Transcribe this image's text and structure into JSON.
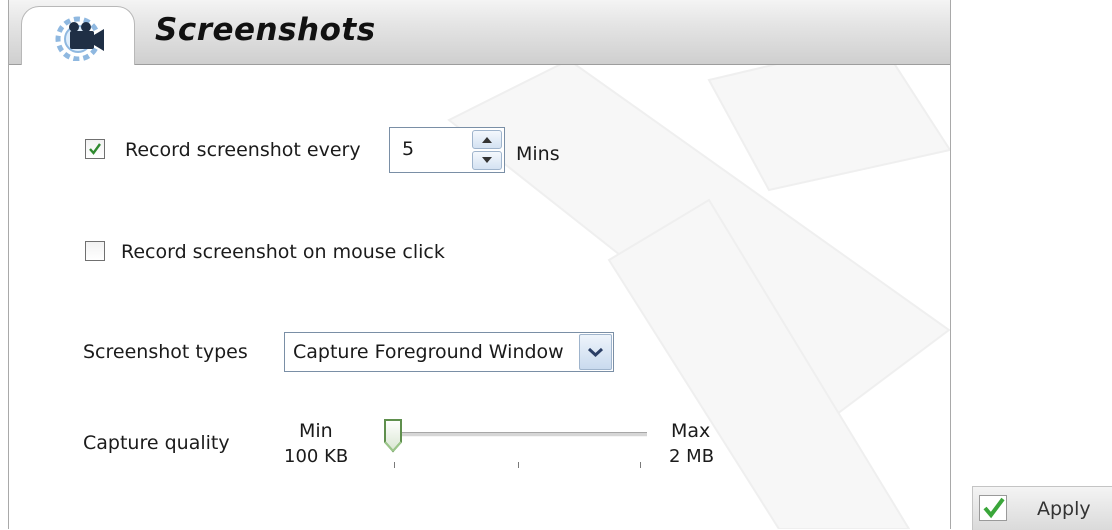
{
  "header": {
    "title": "Screenshots",
    "icon": "gear-camera-icon"
  },
  "interval": {
    "checked": true,
    "label": "Record screenshot every",
    "value": "5",
    "unit": "Mins"
  },
  "mouse_click": {
    "checked": false,
    "label": "Record screenshot on mouse click"
  },
  "types": {
    "label": "Screenshot types",
    "selected": "Capture Foreground Window"
  },
  "quality": {
    "label": "Capture quality",
    "min_label": "Min",
    "min_size": "100 KB",
    "max_label": "Max",
    "max_size": "2 MB",
    "level": 0
  },
  "apply": {
    "label": "Apply"
  },
  "colors": {
    "check_green": "#2f8a2f",
    "apply_green": "#3aa63a",
    "spin_border": "#7a8fa6"
  }
}
